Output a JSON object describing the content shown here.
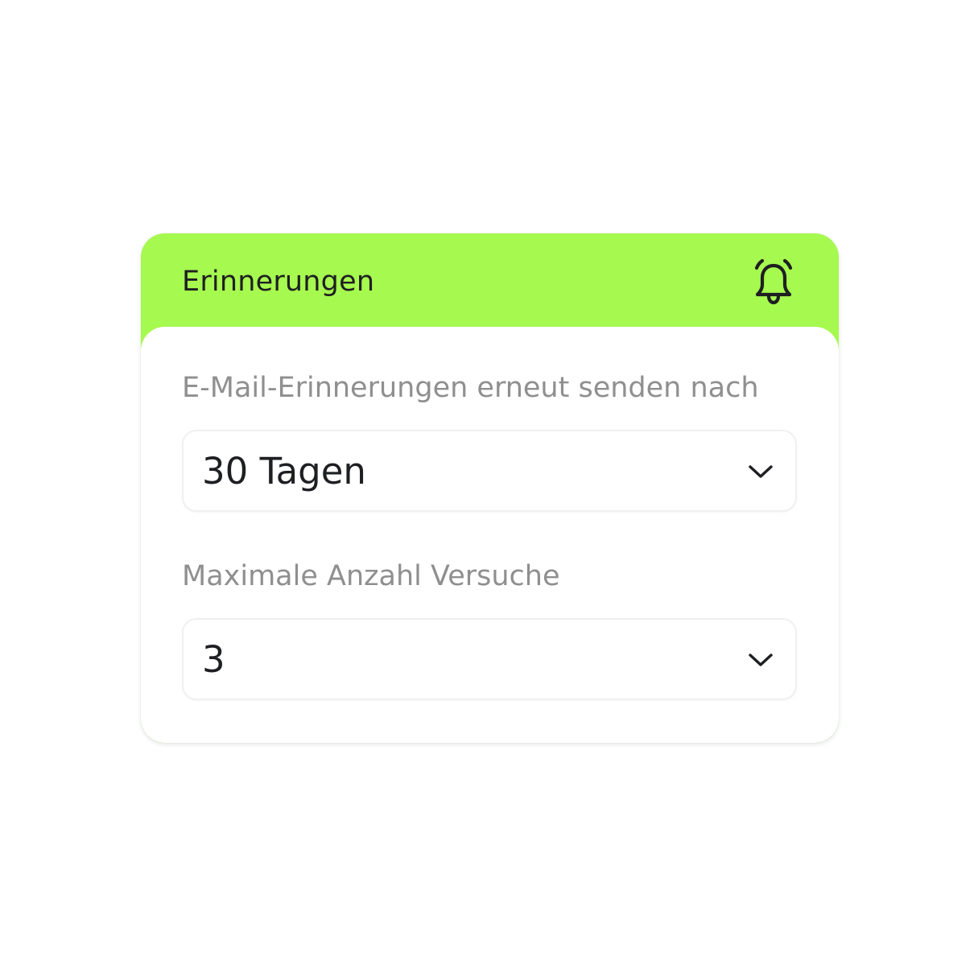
{
  "card": {
    "title": "Erinnerungen",
    "header_icon": "bell-alarm-icon",
    "accent_color": "#a6f94f"
  },
  "fields": [
    {
      "label": "E-Mail-Erinnerungen erneut senden nach",
      "value": "30 Tagen",
      "icon": "chevron-down-icon"
    },
    {
      "label": "Maximale Anzahl Versuche",
      "value": "3",
      "icon": "chevron-down-icon"
    }
  ]
}
